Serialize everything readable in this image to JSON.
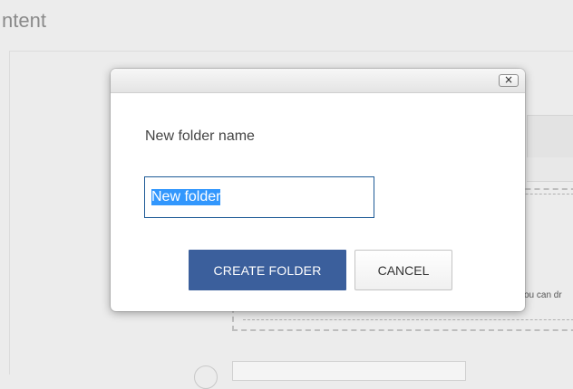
{
  "page": {
    "title": "ntent",
    "dropzone_text": "ou can dr"
  },
  "dialog": {
    "close_label": "×",
    "field_label": "New folder name",
    "input_value": "New folder",
    "create_label": "CREATE FOLDER",
    "cancel_label": "CANCEL"
  },
  "colors": {
    "primary_button": "#3b5f9c",
    "input_border": "#1e5a96",
    "selection": "#3297fd"
  }
}
